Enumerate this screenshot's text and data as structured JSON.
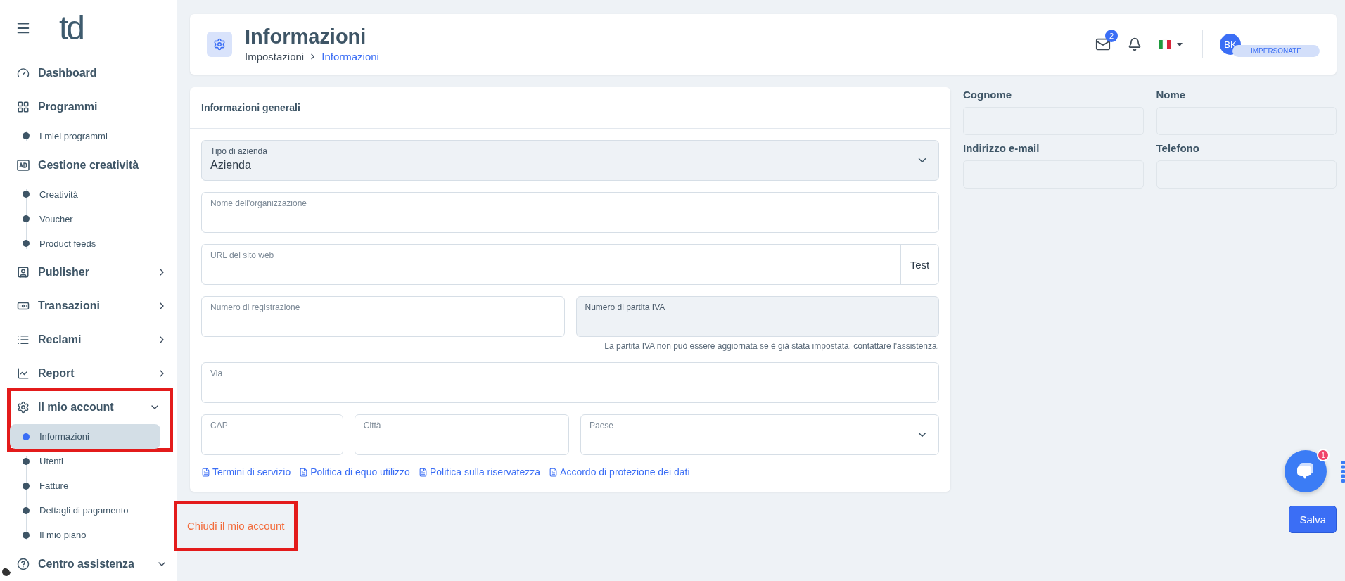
{
  "sidebar": {
    "logo": "td",
    "items": [
      {
        "label": "Dashboard"
      },
      {
        "label": "Programmi",
        "children": [
          {
            "label": "I miei programmi",
            "selected": false
          }
        ]
      },
      {
        "label": "Gestione creatività",
        "children": [
          {
            "label": "Creatività",
            "selected": false
          },
          {
            "label": "Voucher",
            "selected": false
          },
          {
            "label": "Product feeds",
            "selected": false
          }
        ]
      },
      {
        "label": "Publisher",
        "expanded": false
      },
      {
        "label": "Transazioni",
        "expanded": false
      },
      {
        "label": "Reclami",
        "expanded": false
      },
      {
        "label": "Report",
        "expanded": false
      },
      {
        "label": "Il mio account",
        "expanded": true,
        "highlighted": true,
        "children": [
          {
            "label": "Informazioni",
            "selected": true
          },
          {
            "label": "Utenti",
            "selected": false
          },
          {
            "label": "Fatture",
            "selected": false
          },
          {
            "label": "Dettagli di pagamento",
            "selected": false
          },
          {
            "label": "Il mio piano",
            "selected": false
          }
        ]
      },
      {
        "label": "Centro assistenza",
        "expanded": true
      }
    ]
  },
  "header": {
    "title": "Informazioni",
    "breadcrumb": [
      {
        "label": "Impostazioni",
        "selected": false
      },
      {
        "label": "Informazioni",
        "selected": true
      }
    ],
    "mail_badge": "2",
    "avatar": "BK",
    "impersonate": "IMPERSONATE"
  },
  "form": {
    "title": "Informazioni generali",
    "rows": [
      {
        "fields": [
          {
            "kind": "select",
            "label": "Tipo di azienda",
            "value": "Azienda",
            "disabled": true
          }
        ]
      },
      {
        "fields": [
          {
            "kind": "text",
            "label": "Nome dell'organizzazione",
            "disabled": false
          }
        ]
      },
      {
        "fields": [
          {
            "kind": "url",
            "label": "URL del sito web",
            "button": "Test",
            "disabled": false
          }
        ]
      },
      {
        "fields": [
          {
            "kind": "text",
            "label": "Numero di registrazione",
            "disabled": false
          },
          {
            "kind": "text",
            "label": "Numero di partita IVA",
            "disabled": true,
            "help": "La partita IVA non può essere aggiornata se è già stata impostata, contattare l'assistenza."
          }
        ]
      },
      {
        "fields": [
          {
            "kind": "text",
            "label": "Via",
            "disabled": false
          }
        ]
      },
      {
        "fields": [
          {
            "kind": "text",
            "label": "CAP",
            "disabled": false
          },
          {
            "kind": "text",
            "label": "Città",
            "disabled": false
          },
          {
            "kind": "select",
            "label": "Paese",
            "disabled": false
          }
        ]
      }
    ],
    "links": [
      "Termini di servizio",
      "Politica di equo utilizzo",
      "Politica sulla riservatezza",
      "Accordo di protezione dei dati"
    ]
  },
  "contact": [
    {
      "label": "Cognome"
    },
    {
      "label": "Nome"
    },
    {
      "label": "Indirizzo e-mail"
    },
    {
      "label": "Telefono"
    }
  ],
  "close_account": {
    "label": "Chiudi il mio account",
    "highlighted": true
  },
  "save_button": "Salva",
  "chat": {
    "badge": "1"
  }
}
